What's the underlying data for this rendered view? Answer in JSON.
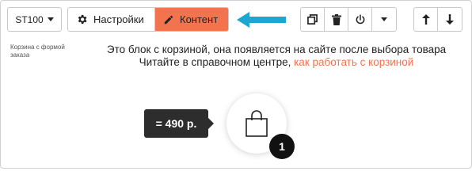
{
  "toolbar": {
    "block_code": "ST100",
    "settings_label": "Настройки",
    "content_label": "Контент",
    "accent_color": "#f4734f",
    "arrow_color": "#1ea6d1",
    "actions": [
      {
        "name": "duplicate",
        "icon": "duplicate-icon"
      },
      {
        "name": "delete",
        "icon": "trash-icon"
      },
      {
        "name": "toggle",
        "icon": "power-icon"
      },
      {
        "name": "more",
        "icon": "chevron-down-icon"
      }
    ],
    "move": [
      {
        "name": "move-up",
        "icon": "arrow-up-icon"
      },
      {
        "name": "move-down",
        "icon": "arrow-down-icon"
      }
    ]
  },
  "block": {
    "label": "Корзина с формой заказа",
    "hint_line1": "Это блок с корзиной, она появляется на сайте после выбора товара",
    "hint_line2_prefix": "Читайте в справочном центре,",
    "hint_link": "как работать с корзиной"
  },
  "cart": {
    "price": "= 490 р.",
    "count": "1"
  }
}
